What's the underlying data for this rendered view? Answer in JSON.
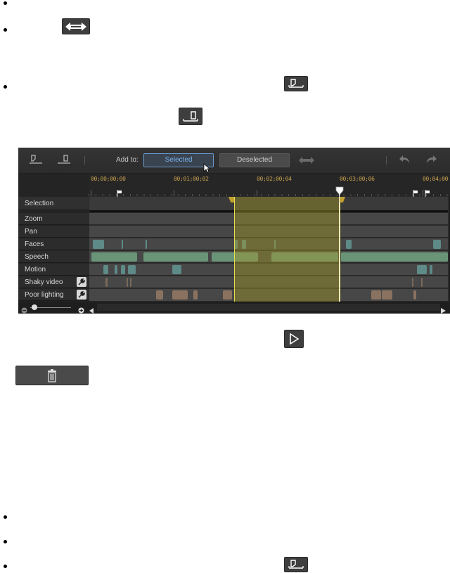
{
  "toolbar": {
    "add_to_label": "Add to:",
    "selected_label": "Selected",
    "deselected_label": "Deselected"
  },
  "ruler": {
    "timecodes": [
      "00;00;00;00",
      "00;01;00;02",
      "00;02;00;04",
      "00;03;00;06",
      "00;04;00"
    ]
  },
  "rows": {
    "selection": "Selection",
    "zoom": "Zoom",
    "pan": "Pan",
    "faces": "Faces",
    "speech": "Speech",
    "motion": "Motion",
    "shaky_video": "Shaky video",
    "poor_lighting": "Poor lighting"
  },
  "colors": {
    "faces_segment": "#5e8a88",
    "speech_segment": "#6a9478",
    "motion_segment": "#5e8a88",
    "shaky_segment": "#7a6a5a",
    "lighting_segment": "#8a7260",
    "selection_highlight": "#6a6a2e",
    "selection_border": "#e8e050",
    "timecode": "#c8a050"
  },
  "icons": [
    "mark-in-icon",
    "mark-out-icon",
    "swap-arrows-icon",
    "undo-icon",
    "redo-icon",
    "play-icon",
    "trash-icon",
    "wrench-icon",
    "zoom-out-icon",
    "zoom-in-icon",
    "scroll-left-icon",
    "scroll-right-icon",
    "flag-icon",
    "playhead-icon",
    "mouse-cursor-icon"
  ]
}
